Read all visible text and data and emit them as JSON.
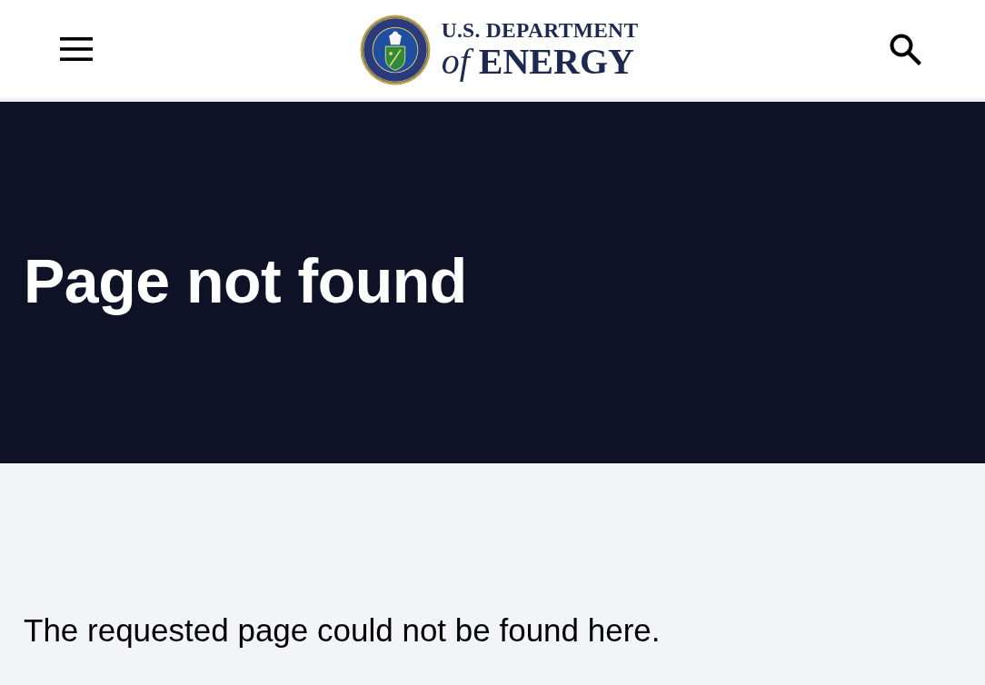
{
  "header": {
    "logo": {
      "line_1": "U.S. DEPARTMENT",
      "line_2": "*of* **ENERGY**"
    }
  },
  "hero": {
    "title": "Page not found"
  },
  "content": {
    "message": "The requested page could not be found here."
  }
}
